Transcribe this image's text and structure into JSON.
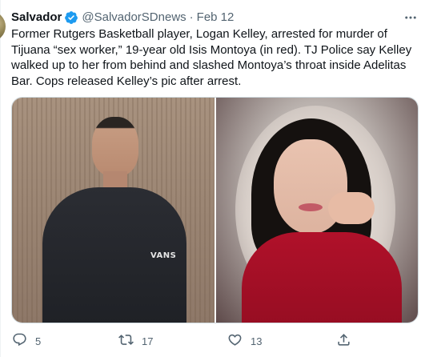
{
  "tweet": {
    "author_name": "Salvador",
    "author_handle": "@SalvadorSDnews",
    "separator": "·",
    "timestamp": "Feb 12",
    "text": "Former Rutgers Basketball player, Logan Kelley, arrested for murder of\nTijuana “sex worker,” 19-year old Isis Montoya (in red). TJ Police say Kelley\nwalked up to her from behind and slashed Montoya’s throat inside Adelitas\nBar. Cops released Kelley’s pic after arrest.",
    "media": [
      {
        "icon": "photo-man-black-hoodie",
        "logo_text": "VANS"
      },
      {
        "icon": "photo-woman-red-top"
      }
    ]
  },
  "actions": {
    "reply_count": "5",
    "retweet_count": "17",
    "like_count": "13",
    "share_count": ""
  },
  "icons": {
    "verified": "verified-badge-icon",
    "more": "more-options-icon",
    "reply": "reply-icon",
    "retweet": "retweet-icon",
    "like": "heart-icon",
    "share": "share-icon"
  },
  "colors": {
    "accent": "#1d9bf0",
    "text": "#0f1419",
    "muted": "#536471",
    "border": "#cfd9de"
  }
}
